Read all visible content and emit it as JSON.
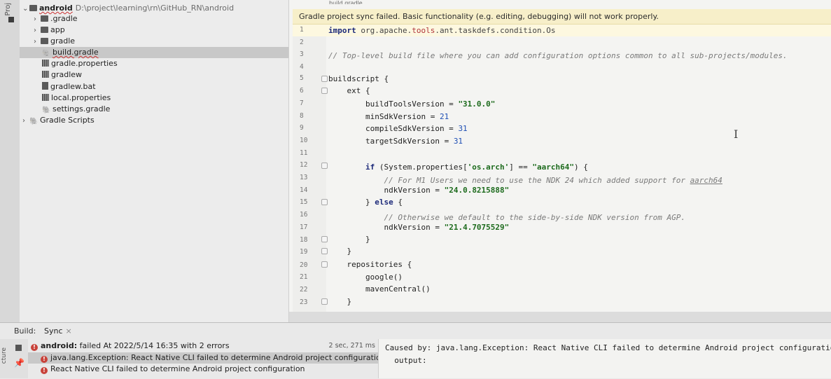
{
  "sidebar": {
    "vertical_tab": "Proj",
    "root": {
      "name": "android",
      "path": "D:\\project\\learning\\rn\\GitHub_RN\\android"
    },
    "items": [
      {
        "label": ".gradle"
      },
      {
        "label": "app"
      },
      {
        "label": "gradle"
      },
      {
        "label": "build.gradle"
      },
      {
        "label": "gradle.properties"
      },
      {
        "label": "gradlew"
      },
      {
        "label": "gradlew.bat"
      },
      {
        "label": "local.properties"
      },
      {
        "label": "settings.gradle"
      }
    ],
    "scripts": "Gradle Scripts"
  },
  "editor": {
    "tab_title": "build.gradle",
    "banner": "Gradle project sync failed. Basic functionality (e.g. editing, debugging) will not work properly.",
    "line_numbers": [
      "1",
      "2",
      "3",
      "4",
      "5",
      "6",
      "7",
      "8",
      "9",
      "10",
      "11",
      "12",
      "13",
      "14",
      "15",
      "16",
      "17",
      "18",
      "19",
      "20",
      "21",
      "22",
      "23"
    ],
    "code": {
      "l1_kw": "import",
      "l1_pkg": " org.apache.",
      "l1_mid": "tools",
      "l1_rest": ".ant.taskdefs.condition.Os",
      "l3": "// Top-level build file where you can add configuration options common to all sub-projects/modules.",
      "l5": "buildscript {",
      "l6": "    ext {",
      "l7_a": "        buildToolsVersion = ",
      "l7_b": "\"31.0.0\"",
      "l8_a": "        minSdkVersion = ",
      "l8_b": "21",
      "l9_a": "        compileSdkVersion = ",
      "l9_b": "31",
      "l10_a": "        targetSdkVersion = ",
      "l10_b": "31",
      "l12_a": "        if",
      "l12_b": " (System.properties[",
      "l12_c": "'os.arch'",
      "l12_d": "] == ",
      "l12_e": "\"aarch64\"",
      "l12_f": ") {",
      "l13_a": "            // For M1 Users we need to use the NDK 24 which added support for ",
      "l13_b": "aarch64",
      "l14_a": "            ndkVersion = ",
      "l14_b": "\"24.0.8215888\"",
      "l15_a": "        } ",
      "l15_b": "else",
      "l15_c": " {",
      "l16": "            // Otherwise we default to the side-by-side NDK version from AGP.",
      "l17_a": "            ndkVersion = ",
      "l17_b": "\"21.4.7075529\"",
      "l18": "        }",
      "l19": "    }",
      "l20": "    repositories {",
      "l21": "        google()",
      "l22": "        mavenCentral()",
      "l23": "    }"
    }
  },
  "build": {
    "label": "Build:",
    "tab": "Sync",
    "tab_close": "×",
    "left_label": "cture",
    "rows": [
      {
        "name": "android:",
        "text": " failed At 2022/5/14 16:35 with 2 errors",
        "time": "2 sec, 271 ms"
      },
      {
        "text": "java.lang.Exception: React Native CLI failed to determine Android project configuration. This is like"
      },
      {
        "text": "React Native CLI failed to determine Android project configuration"
      }
    ],
    "console": [
      "Caused by: java.lang.Exception: React Native CLI failed to determine Android project configuration.",
      "  output:"
    ]
  }
}
